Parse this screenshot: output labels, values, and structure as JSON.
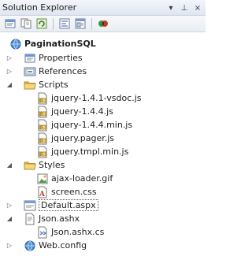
{
  "window": {
    "title": "Solution Explorer",
    "controls": [
      "▾",
      "⊥",
      "×"
    ]
  },
  "toolbar": {
    "buttons": [
      "properties-icon",
      "show-all-files-icon",
      "refresh-icon",
      "view-code-icon",
      "view-designer-icon",
      "class-diagram-icon"
    ]
  },
  "tree": {
    "project": "PaginationSQL",
    "properties": "Properties",
    "references": "References",
    "scripts": "Scripts",
    "scripts_items": [
      "jquery-1.4.1-vsdoc.js",
      "jquery-1.4.4.js",
      "jquery-1.4.4.min.js",
      "jquery.pager.js",
      "jquery.tmpl.min.js"
    ],
    "styles": "Styles",
    "styles_items": [
      "ajax-loader.gif",
      "screen.css"
    ],
    "default_aspx": "Default.aspx",
    "json_ashx": "Json.ashx",
    "json_ashx_cs": "Json.ashx.cs",
    "web_config": "Web.config"
  },
  "colors": {
    "folder": "#e8c15a",
    "selection_border": "#555555"
  }
}
